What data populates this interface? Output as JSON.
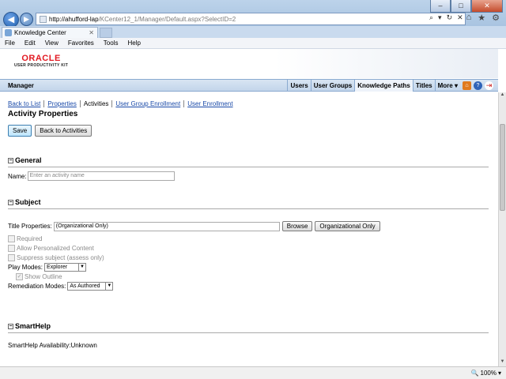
{
  "browser": {
    "url_host": "http://ahufford-lap",
    "url_path": "/KCenter12_1/Manager/Default.aspx?SelectID=2",
    "tab_title": "Knowledge Center",
    "menu": [
      "File",
      "Edit",
      "View",
      "Favorites",
      "Tools",
      "Help"
    ],
    "zoom": "100%"
  },
  "brand": {
    "logo_line1": "ORACLE",
    "logo_line2": "USER PRODUCTIVITY KIT"
  },
  "manager": {
    "title": "Manager",
    "nav": [
      "Users",
      "User Groups",
      "Knowledge Paths",
      "Titles",
      "More"
    ],
    "active_nav": "Knowledge Paths"
  },
  "breadcrumbs": {
    "back_to_list": "Back to List",
    "properties": "Properties",
    "activities": "Activities",
    "user_group_enrollment": "User Group Enrollment",
    "user_enrollment": "User Enrollment"
  },
  "page_title": "Activity Properties",
  "buttons": {
    "save": "Save",
    "back_to_activities": "Back to Activities"
  },
  "general": {
    "heading": "General",
    "name_label": "Name:",
    "name_placeholder": "Enter an activity name"
  },
  "subject": {
    "heading": "Subject",
    "title_properties_label": "Title Properties:",
    "title_properties_value": "(Organizational Only)",
    "browse": "Browse",
    "organizational_only": "Organizational Only",
    "required": "Required",
    "allow_personalized": "Allow Personalized Content",
    "suppress_subject": "Suppress subject (assess only)",
    "play_modes_label": "Play Modes:",
    "play_modes_value": "Explorer",
    "show_outline": "Show Outline",
    "remediation_label": "Remediation Modes:",
    "remediation_value": "As Authored"
  },
  "smarthelp": {
    "heading": "SmartHelp",
    "availability_label": "SmartHelp Availability:",
    "availability_value": "Unknown"
  },
  "colors": {
    "oracle_red": "#e21a22",
    "link_blue": "#1a4aa8",
    "bar_blue": "#c3d5ea"
  }
}
